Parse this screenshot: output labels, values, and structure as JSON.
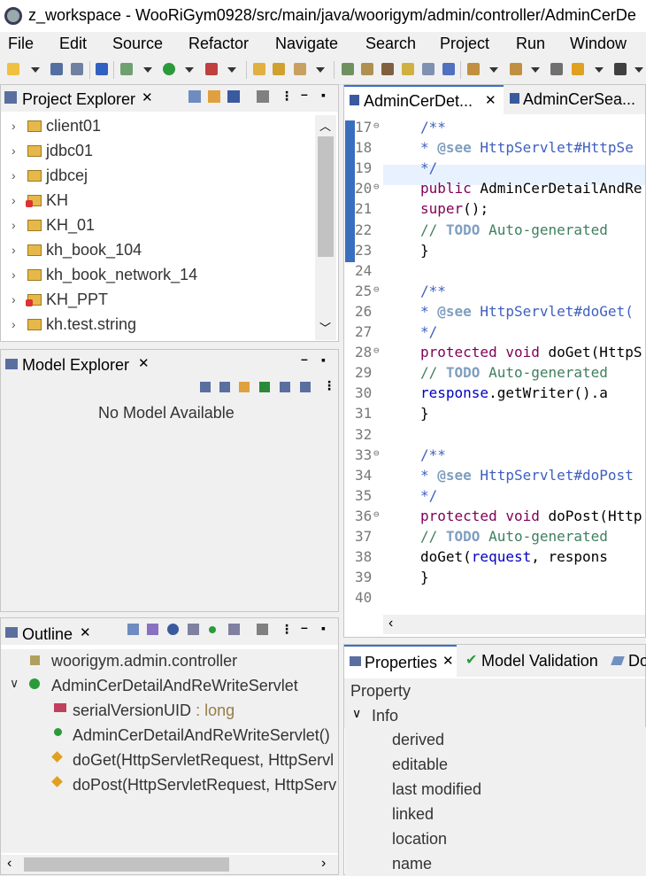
{
  "window": {
    "title": "z_workspace - WooRiGym0928/src/main/java/woorigym/admin/controller/AdminCerDe"
  },
  "menu": [
    "File",
    "Edit",
    "Source",
    "Refactor",
    "Navigate",
    "Search",
    "Project",
    "Run",
    "Window"
  ],
  "project_explorer": {
    "title": "Project Explorer",
    "items": [
      {
        "label": "client01",
        "error": false
      },
      {
        "label": "jdbc01",
        "error": false
      },
      {
        "label": "jdbcej",
        "error": false
      },
      {
        "label": "KH",
        "error": true
      },
      {
        "label": "KH_01",
        "error": false
      },
      {
        "label": "kh_book_104",
        "error": false
      },
      {
        "label": "kh_book_network_14",
        "error": false
      },
      {
        "label": "KH_PPT",
        "error": true
      },
      {
        "label": "kh.test.string",
        "error": false
      }
    ]
  },
  "model_explorer": {
    "title": "Model Explorer",
    "empty_text": "No Model Available"
  },
  "outline": {
    "title": "Outline",
    "package": "woorigym.admin.controller",
    "class": "AdminCerDetailAndReWriteServlet",
    "members": [
      {
        "label": "serialVersionUID",
        "type": " : long"
      },
      {
        "label": "AdminCerDetailAndReWriteServlet()",
        "type": ""
      },
      {
        "label": "doGet(HttpServletRequest, HttpServl",
        "type": ""
      },
      {
        "label": "doPost(HttpServletRequest, HttpServ",
        "type": ""
      }
    ]
  },
  "editor": {
    "tabs": [
      "AdminCerDet...",
      "AdminCerSea..."
    ],
    "lines": [
      {
        "n": "17",
        "fold": "⊖",
        "text": "    /**"
      },
      {
        "n": "18",
        "fold": "",
        "text": "     * @see HttpServlet#HttpSe"
      },
      {
        "n": "19",
        "fold": "",
        "text": "     */"
      },
      {
        "n": "20",
        "fold": "⊖",
        "text": "    public AdminCerDetailAndRe"
      },
      {
        "n": "21",
        "fold": "",
        "text": "        super();"
      },
      {
        "n": "22",
        "fold": "",
        "text": "        // TODO Auto-generated"
      },
      {
        "n": "23",
        "fold": "",
        "text": "    }"
      },
      {
        "n": "24",
        "fold": "",
        "text": ""
      },
      {
        "n": "25",
        "fold": "⊖",
        "text": "    /**"
      },
      {
        "n": "26",
        "fold": "",
        "text": "     * @see HttpServlet#doGet("
      },
      {
        "n": "27",
        "fold": "",
        "text": "     */"
      },
      {
        "n": "28",
        "fold": "⊖",
        "text": "    protected void doGet(HttpS"
      },
      {
        "n": "29",
        "fold": "",
        "text": "        // TODO Auto-generated"
      },
      {
        "n": "30",
        "fold": "",
        "text": "        response.getWriter().a"
      },
      {
        "n": "31",
        "fold": "",
        "text": "    }"
      },
      {
        "n": "32",
        "fold": "",
        "text": ""
      },
      {
        "n": "33",
        "fold": "⊖",
        "text": "    /**"
      },
      {
        "n": "34",
        "fold": "",
        "text": "     * @see HttpServlet#doPost"
      },
      {
        "n": "35",
        "fold": "",
        "text": "     */"
      },
      {
        "n": "36",
        "fold": "⊖",
        "text": "    protected void doPost(Http"
      },
      {
        "n": "37",
        "fold": "",
        "text": "        // TODO Auto-generated"
      },
      {
        "n": "38",
        "fold": "",
        "text": "        doGet(request, respons"
      },
      {
        "n": "39",
        "fold": "",
        "text": "    }"
      },
      {
        "n": "40",
        "fold": "",
        "text": ""
      }
    ]
  },
  "bottom_tabs": [
    "Properties",
    "Model Validation",
    "Do"
  ],
  "properties": {
    "header": "Property",
    "group": "Info",
    "rows": [
      "derived",
      "editable",
      "last modified",
      "linked",
      "location",
      "name"
    ]
  }
}
